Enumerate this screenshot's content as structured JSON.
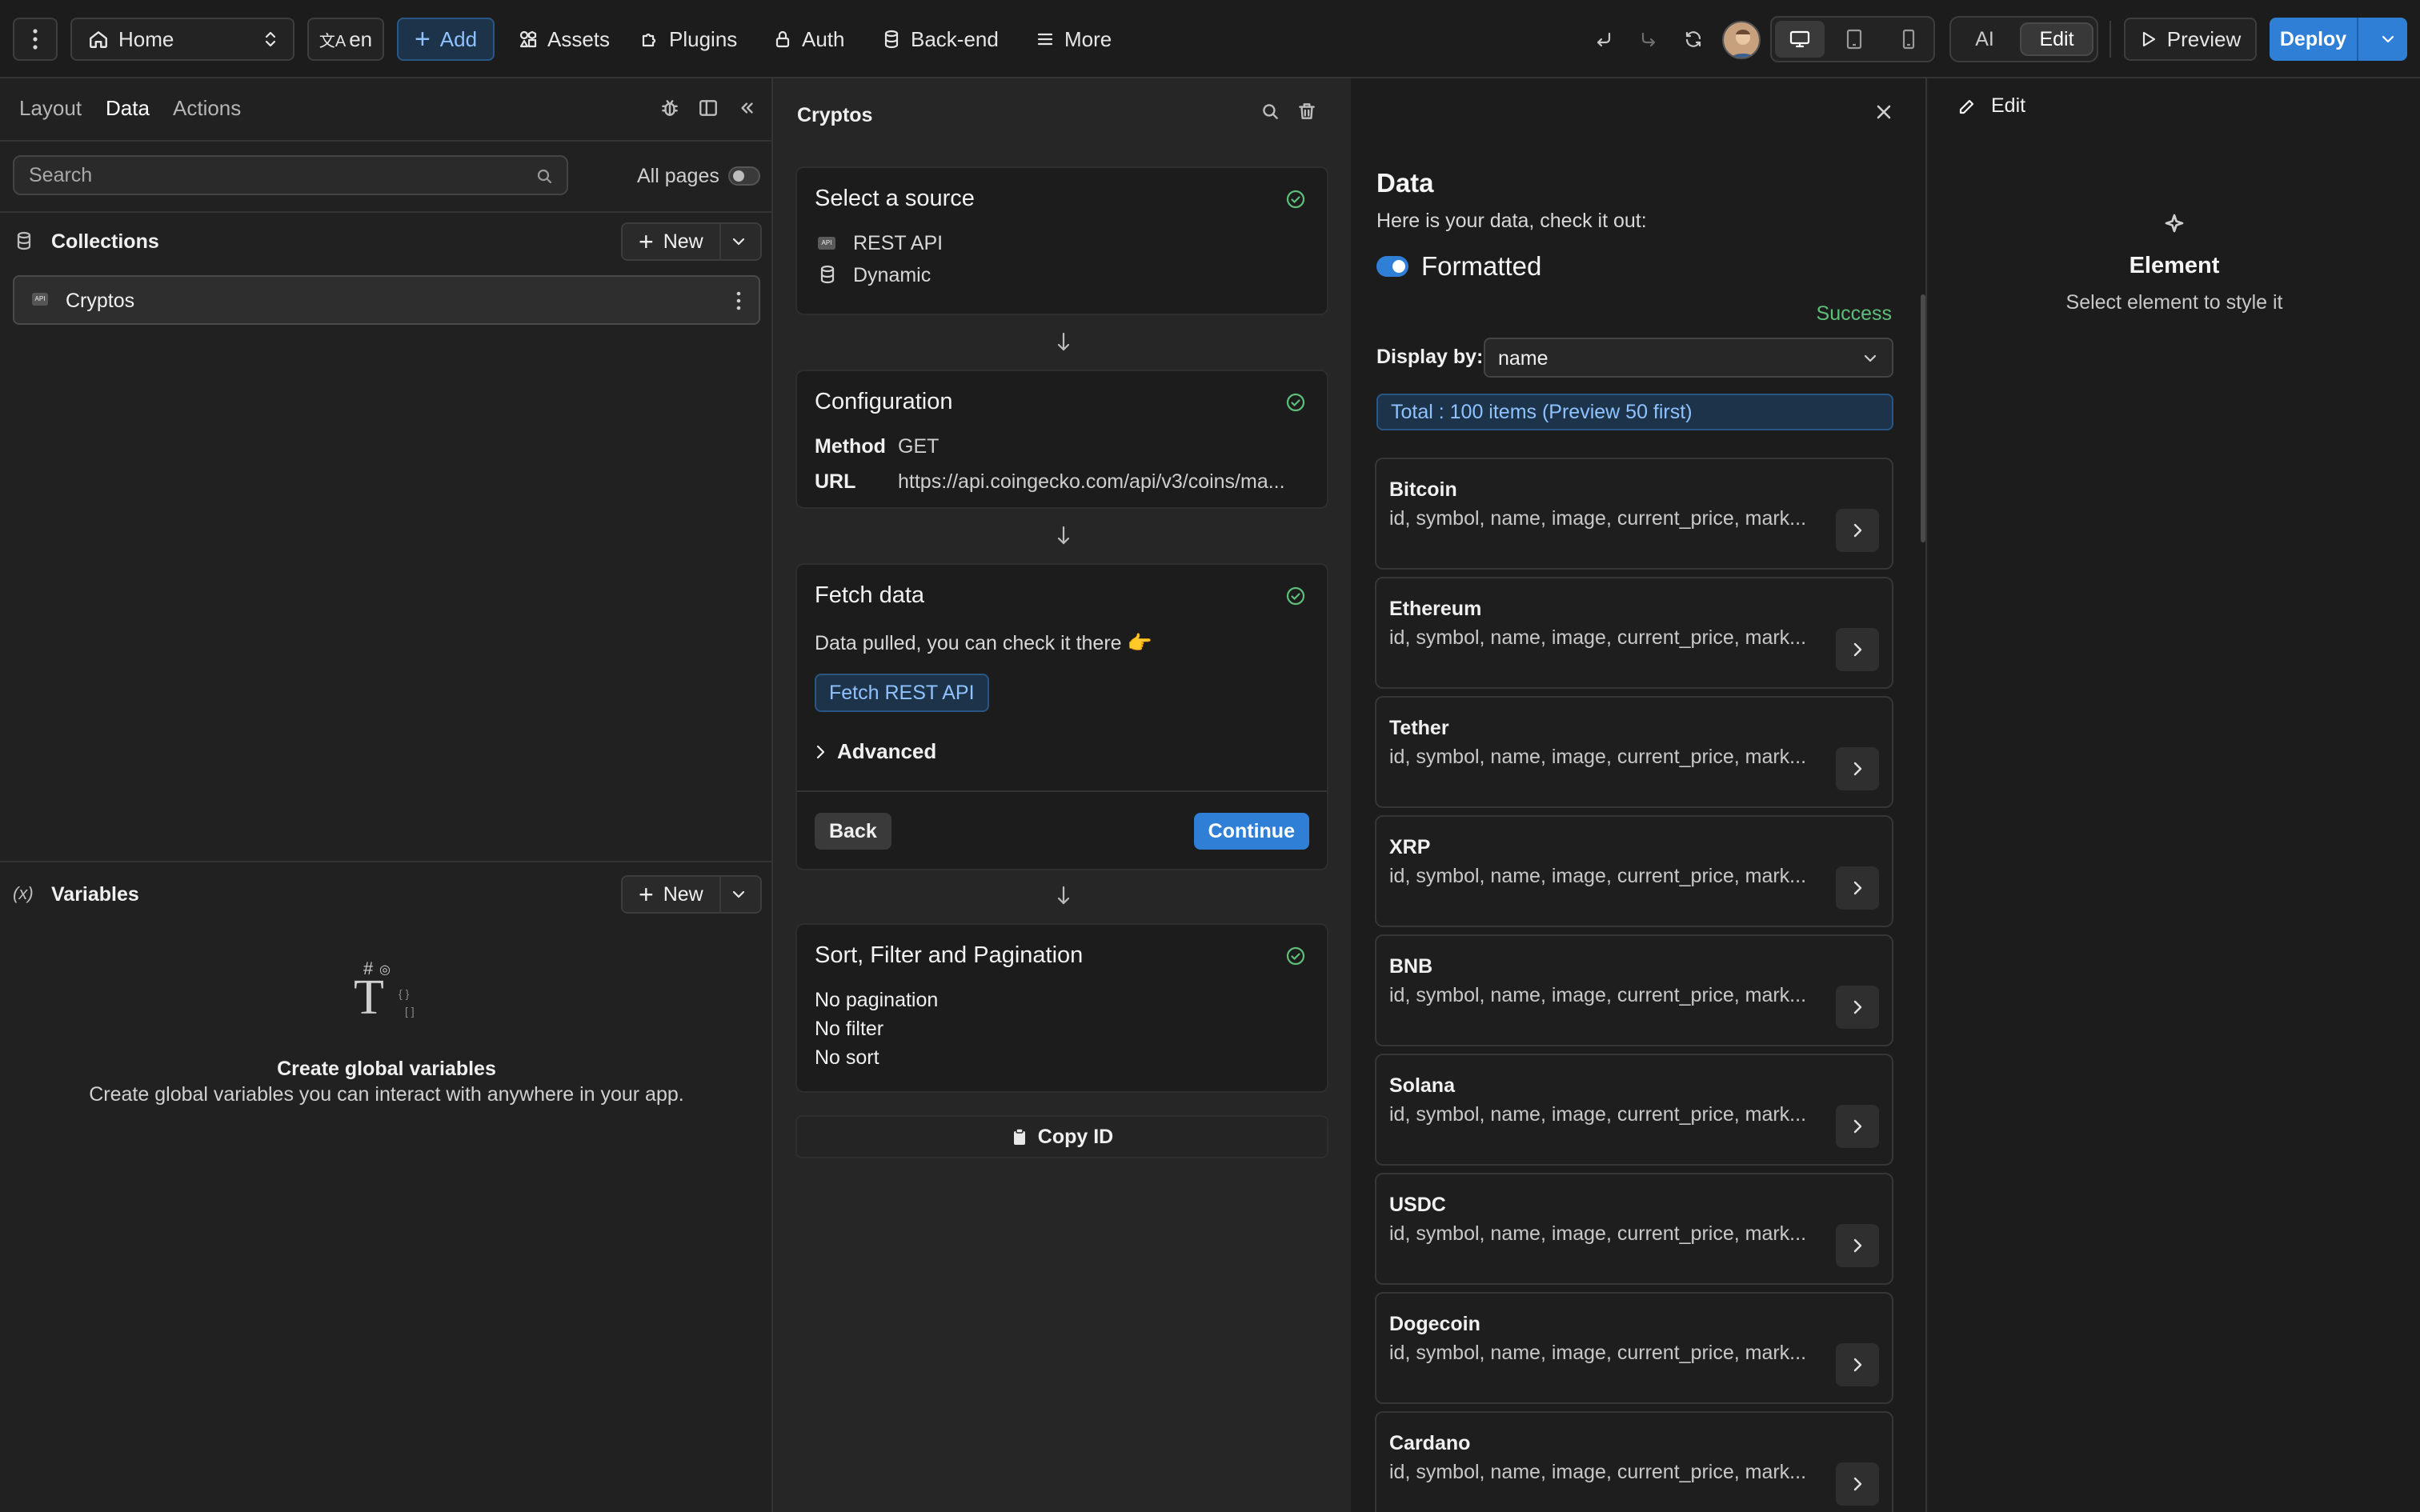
{
  "topbar": {
    "page_select": "Home",
    "language": "en",
    "add_label": "Add",
    "nav": [
      "Assets",
      "Plugins",
      "Auth",
      "Back-end",
      "More"
    ],
    "mode_ai": "AI",
    "mode_edit": "Edit",
    "preview_label": "Preview",
    "deploy_label": "Deploy"
  },
  "left": {
    "tabs": [
      "Layout",
      "Data",
      "Actions"
    ],
    "active_tab": "Data",
    "search_placeholder": "Search",
    "all_pages_label": "All pages",
    "collections_title": "Collections",
    "new_label": "New",
    "collections": [
      {
        "name": "Cryptos"
      }
    ],
    "variables_title": "Variables",
    "variables_new_label": "New",
    "empty_title": "Create global variables",
    "empty_desc": "Create global variables you can interact with anywhere in your app."
  },
  "middle": {
    "title": "Cryptos",
    "source": {
      "title": "Select a source",
      "options": [
        "REST API",
        "Dynamic"
      ]
    },
    "configuration": {
      "title": "Configuration",
      "method_label": "Method",
      "method_value": "GET",
      "url_label": "URL",
      "url_value": "https://api.coingecko.com/api/v3/coins/ma..."
    },
    "fetch": {
      "title": "Fetch data",
      "desc": "Data pulled, you can check it there 👉",
      "button": "Fetch REST API",
      "advanced": "Advanced",
      "back": "Back",
      "continue": "Continue"
    },
    "sort": {
      "title": "Sort, Filter and Pagination",
      "lines": [
        "No pagination",
        "No filter",
        "No sort"
      ]
    },
    "copy_id": "Copy ID"
  },
  "data": {
    "title": "Data",
    "subtitle": "Here is your data, check it out:",
    "formatted_label": "Formatted",
    "status": "Success",
    "display_by_label": "Display by:",
    "display_by_value": "name",
    "total": "Total : 100 items (Preview 50 first)",
    "fields": "id, symbol, name, image, current_price, mark...",
    "items": [
      "Bitcoin",
      "Ethereum",
      "Tether",
      "XRP",
      "BNB",
      "Solana",
      "USDC",
      "Dogecoin",
      "Cardano"
    ]
  },
  "right": {
    "edit_label": "Edit",
    "element_title": "Element",
    "element_desc": "Select element to style it"
  },
  "colors": {
    "accent": "#2f7fd6",
    "success": "#5fbf7a",
    "info_bg": "#1d3349",
    "info_text": "#8fc2ff"
  }
}
